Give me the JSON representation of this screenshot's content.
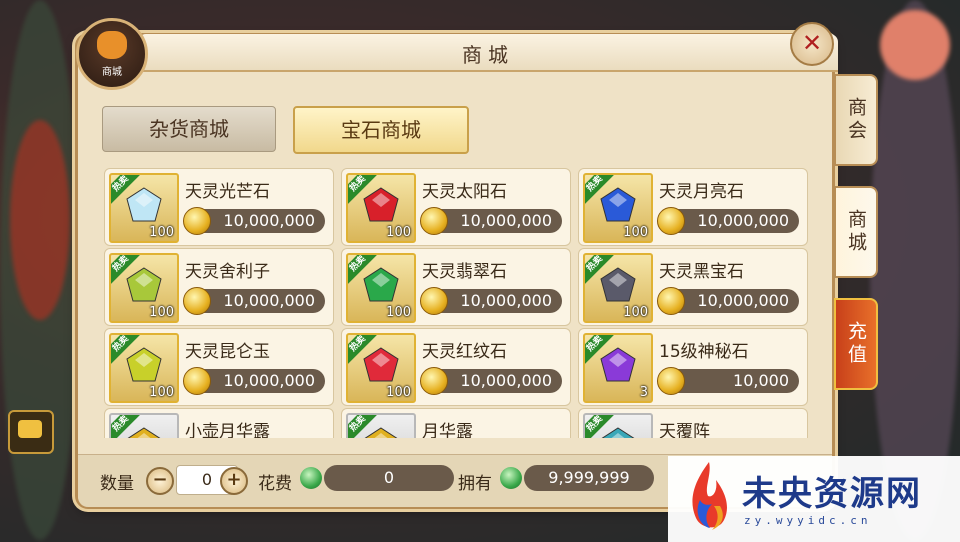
{
  "window": {
    "title": "商城",
    "badge_label": "商城",
    "close_symbol": "✕"
  },
  "category_tabs": [
    {
      "label": "杂货商城",
      "active": false
    },
    {
      "label": "宝石商城",
      "active": true
    }
  ],
  "side_tabs": [
    {
      "label": "商会"
    },
    {
      "label": "商城",
      "active": true
    },
    {
      "label": "充值"
    }
  ],
  "hot_label": "热卖",
  "items": [
    {
      "name": "天灵光芒石",
      "price": "10,000,000",
      "qty": "100",
      "gem": "gem-diamond-icon",
      "color": "#bfe6f5"
    },
    {
      "name": "天灵太阳石",
      "price": "10,000,000",
      "qty": "100",
      "gem": "gem-ruby-icon",
      "color": "#d8202a"
    },
    {
      "name": "天灵月亮石",
      "price": "10,000,000",
      "qty": "100",
      "gem": "gem-moon-icon",
      "color": "#2a5ad8"
    },
    {
      "name": "天灵舍利子",
      "price": "10,000,000",
      "qty": "100",
      "gem": "gem-pearl-icon",
      "color": "#a8c83a"
    },
    {
      "name": "天灵翡翠石",
      "price": "10,000,000",
      "qty": "100",
      "gem": "gem-emerald-icon",
      "color": "#2aa84a"
    },
    {
      "name": "天灵黑宝石",
      "price": "10,000,000",
      "qty": "100",
      "gem": "gem-black-icon",
      "color": "#5a5a6a"
    },
    {
      "name": "天灵昆仑玉",
      "price": "10,000,000",
      "qty": "100",
      "gem": "gem-jade-icon",
      "color": "#c8d02a"
    },
    {
      "name": "天灵红纹石",
      "price": "10,000,000",
      "qty": "100",
      "gem": "gem-red-icon",
      "color": "#e02a3a"
    },
    {
      "name": "15级神秘石",
      "price": "10,000",
      "qty": "3",
      "gem": "gem-mystic-icon",
      "color": "#8a3ad8"
    },
    {
      "name": "小壶月华露",
      "price": "",
      "qty": "",
      "gem": "potion-icon",
      "color": "#e0b020"
    },
    {
      "name": "月华露",
      "price": "",
      "qty": "",
      "gem": "potion-icon",
      "color": "#e0b020"
    },
    {
      "name": "天覆阵",
      "price": "",
      "qty": "",
      "gem": "scroll-icon",
      "color": "#3aa8b8"
    }
  ],
  "bottom": {
    "qty_label": "数量",
    "qty_value": "0",
    "minus": "−",
    "plus": "+",
    "cost_label": "花费",
    "cost_value": "0",
    "owned_label": "拥有",
    "owned_value": "9,999,999"
  },
  "watermark": {
    "name": "未央资源网",
    "url": "zy.wyyidc.cn"
  }
}
